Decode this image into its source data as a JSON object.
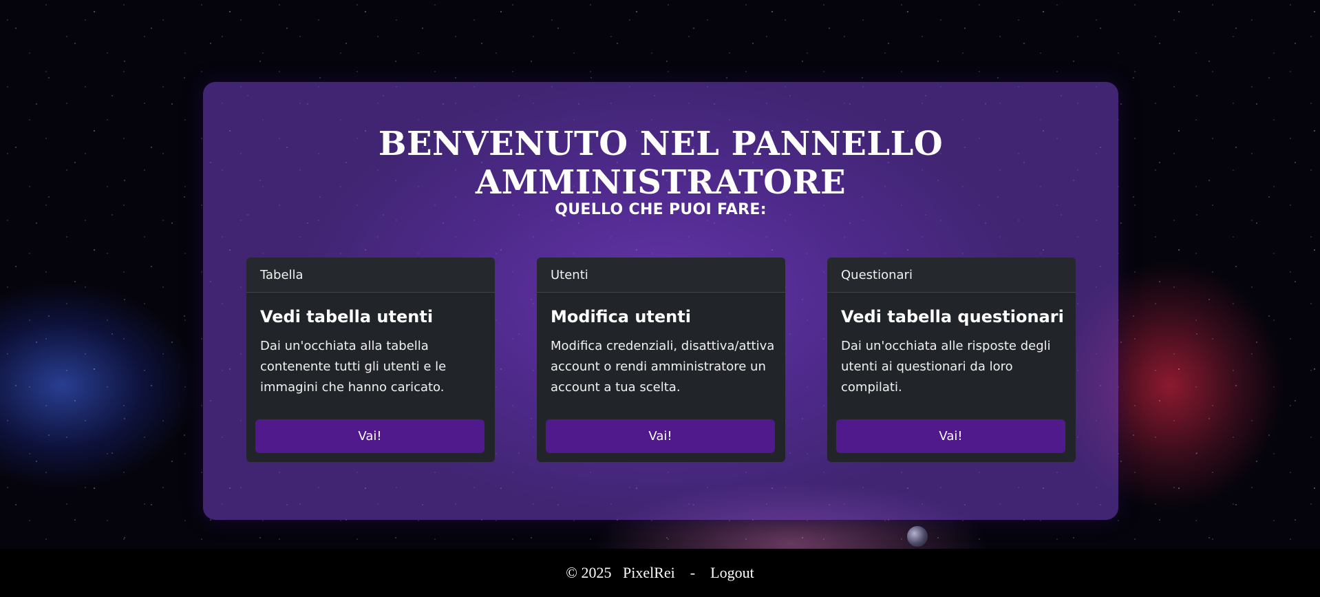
{
  "panel": {
    "title": "BENVENUTO NEL PANNELLO AMMINISTRATORE",
    "subtitle": "Quello che puoi fare:"
  },
  "cards": [
    {
      "header": "Tabella",
      "title": "Vedi tabella utenti",
      "text": "Dai un'occhiata alla tabella contenente tutti gli utenti e le immagini che hanno caricato.",
      "button": "Vai!"
    },
    {
      "header": "Utenti",
      "title": "Modifica utenti",
      "text": "Modifica credenziali, disattiva/attiva account o rendi amministratore un account a tua scelta.",
      "button": "Vai!"
    },
    {
      "header": "Questionari",
      "title": "Vedi tabella questionari",
      "text": "Dai un'occhiata alle risposte degli utenti ai questionari da loro compilati.",
      "button": "Vai!"
    }
  ],
  "footer": {
    "copyright": "© 2025",
    "brand": "PixelRei",
    "separator": "-",
    "logout": "Logout"
  },
  "colors": {
    "panel_bg": "#7341c8",
    "card_bg": "#212529",
    "button_bg": "#50198c",
    "footer_bg": "#000000"
  }
}
